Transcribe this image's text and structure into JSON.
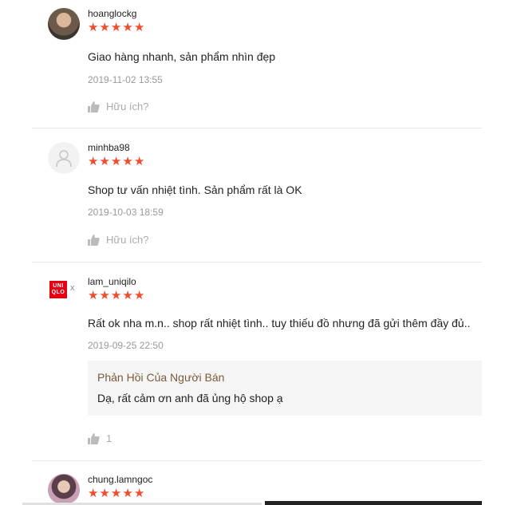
{
  "reviews": [
    {
      "username": "hoanglockg",
      "rating": 5,
      "comment": "Giao hàng nhanh, sản phẩm nhìn đẹp",
      "date": "2019-11-02 13:55",
      "helpful_label": "Hữu ích?"
    },
    {
      "username": "minhba98",
      "rating": 5,
      "comment": "Shop tư vấn nhiệt tình. Sản phẩm rất là OK",
      "date": "2019-10-03 18:59",
      "helpful_label": "Hữu ích?"
    },
    {
      "username": "lam_uniqilo",
      "avatar_brand": {
        "line1": "UNI",
        "line2": "QLO",
        "suffix": "x"
      },
      "rating": 5,
      "comment": "Rất ok nha m.n.. shop rất nhiệt tình.. tuy thiếu đồ nhưng đã gửi thêm đầy đủ..",
      "date": "2019-09-25 22:50",
      "seller_reply": {
        "title": "Phản Hồi Của Người Bán",
        "text": "Dạ, rất cảm ơn anh đã ủng hộ shop ạ"
      },
      "helpful_count": "1"
    },
    {
      "username": "chung.lamngoc",
      "rating": 5
    }
  ],
  "colors": {
    "star": "#ee4d2d",
    "brand_red": "#e60012",
    "seller_title": "#7a5a3a"
  },
  "icons": [
    "thumbs-up-icon",
    "user-placeholder-icon",
    "star-icon"
  ]
}
